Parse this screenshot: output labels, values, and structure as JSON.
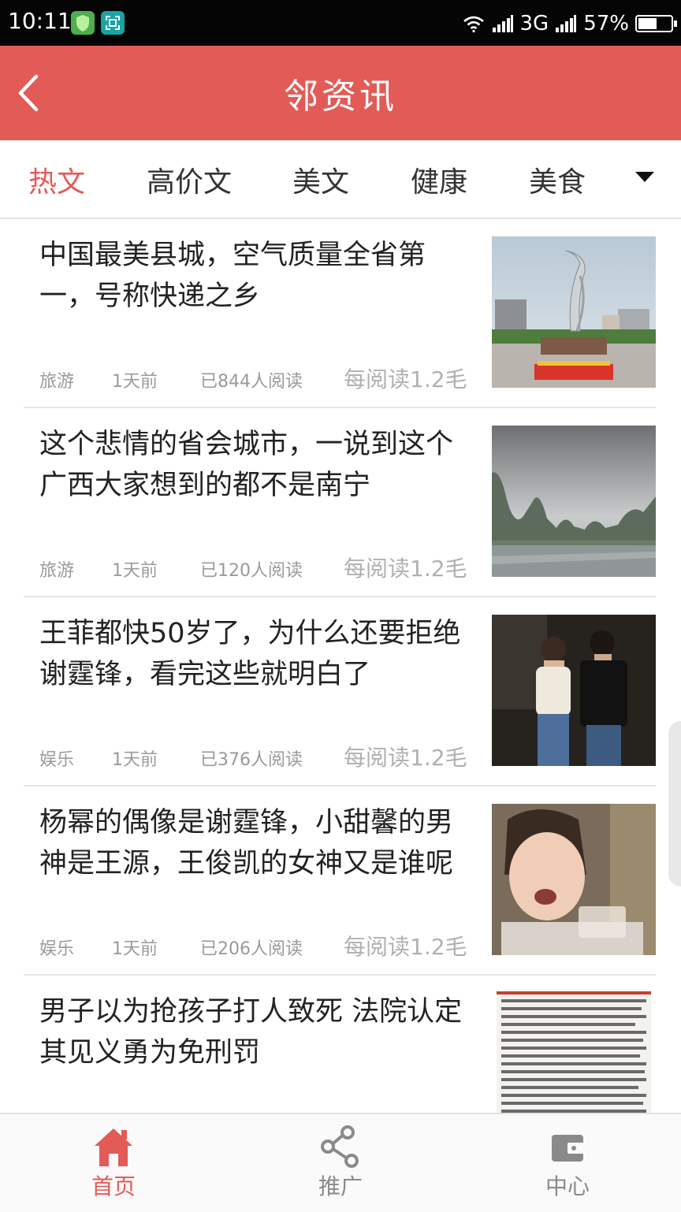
{
  "status_bar": {
    "time": "10:11",
    "network": "3G",
    "battery_percent": "57%",
    "battery_level": 0.57
  },
  "header": {
    "title": "邻资讯",
    "back_icon": "chevron-left-icon",
    "background": "#e35b57"
  },
  "tabs": {
    "items": [
      "热文",
      "高价文",
      "美文",
      "健康",
      "美食"
    ],
    "active_index": 0,
    "more_icon": "caret-down-icon"
  },
  "articles": [
    {
      "title": "中国最美县城，空气质量全省第一，号称快递之乡",
      "category": "旅游",
      "time": "1天前",
      "reads": "已844人阅读",
      "reward": "每阅读1.2毛",
      "image": "city-sculpture-plaza"
    },
    {
      "title": "这个悲情的省会城市，一说到这个广西大家想到的都不是南宁",
      "category": "旅游",
      "time": "1天前",
      "reads": "已120人阅读",
      "reward": "每阅读1.2毛",
      "image": "karst-river-landscape"
    },
    {
      "title": "王菲都快50岁了，为什么还要拒绝谢霆锋，看完这些就明白了",
      "category": "娱乐",
      "time": "1天前",
      "reads": "已376人阅读",
      "reward": "每阅读1.2毛",
      "image": "couple-photo"
    },
    {
      "title": "杨幂的偶像是谢霆锋，小甜馨的男神是王源，王俊凯的女神又是谁呢",
      "category": "娱乐",
      "time": "1天前",
      "reads": "已206人阅读",
      "reward": "每阅读1.2毛",
      "image": "child-tv-screenshot"
    },
    {
      "title": "男子以为抢孩子打人致死 法院认定其见义勇为免刑罚",
      "image": "document-scan"
    }
  ],
  "bottom_nav": {
    "items": [
      {
        "label": "首页",
        "icon": "home-icon"
      },
      {
        "label": "推广",
        "icon": "share-icon"
      },
      {
        "label": "中心",
        "icon": "wallet-icon"
      }
    ],
    "active_index": 0,
    "active_color": "#e35b57",
    "inactive_color": "#8a8a8a"
  }
}
